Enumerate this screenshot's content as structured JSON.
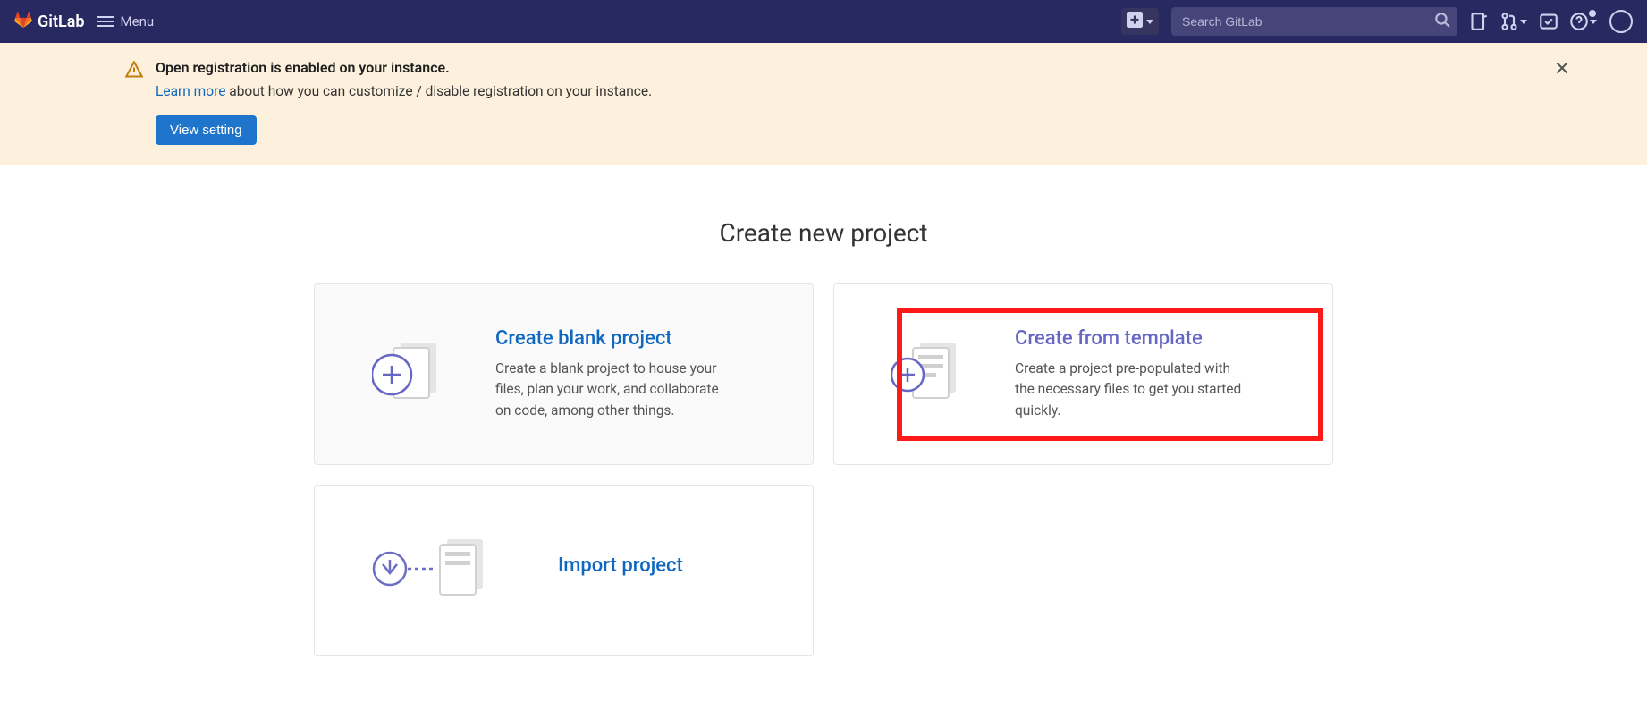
{
  "nav": {
    "brand": "GitLab",
    "menu_label": "Menu",
    "search_placeholder": "Search GitLab"
  },
  "alert": {
    "title": "Open registration is enabled on your instance.",
    "learn_more": "Learn more",
    "desc_rest": " about how you can customize / disable registration on your instance.",
    "button": "View setting"
  },
  "page": {
    "title": "Create new project"
  },
  "cards": {
    "blank": {
      "title": "Create blank project",
      "desc": "Create a blank project to house your files, plan your work, and collaborate on code, among other things."
    },
    "template": {
      "title": "Create from template",
      "desc": "Create a project pre-populated with the necessary files to get you started quickly."
    },
    "import": {
      "title": "Import project"
    }
  }
}
